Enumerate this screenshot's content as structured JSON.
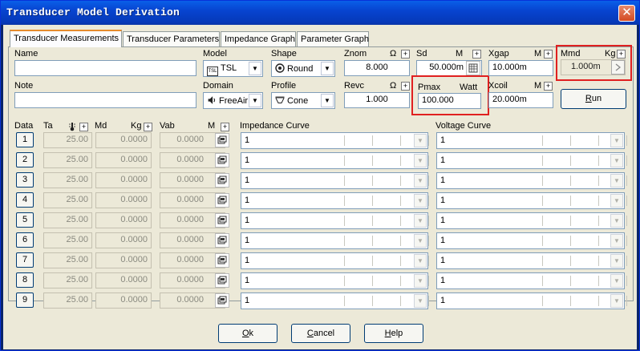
{
  "window": {
    "title": "Transducer Model Derivation",
    "close_glyph": "✕"
  },
  "tabs": [
    {
      "label": "Transducer Measurements",
      "active": true
    },
    {
      "label": "Transducer Parameters",
      "active": false
    },
    {
      "label": "Impedance Graph",
      "active": false
    },
    {
      "label": "Parameter Graph",
      "active": false
    }
  ],
  "form": {
    "name_label": "Name",
    "name_value": "",
    "note_label": "Note",
    "note_value": "",
    "model_label": "Model",
    "model_value": "TSL",
    "model_icon_text": "TSL",
    "domain_label": "Domain",
    "domain_value": "FreeAir",
    "shape_label": "Shape",
    "shape_value": "Round",
    "profile_label": "Profile",
    "profile_value": "Cone",
    "znom_label": "Znom",
    "znom_unit": "Ω",
    "znom_value": "8.000",
    "revc_label": "Revc",
    "revc_unit": "Ω",
    "revc_value": "1.000",
    "sd_label": "Sd",
    "sd_unit": "M",
    "sd_value": "50.000m",
    "pmax_label": "Pmax",
    "pmax_unit": "Watt",
    "pmax_value": "100.000",
    "xgap_label": "Xgap",
    "xgap_unit": "M",
    "xgap_value": "10.000m",
    "xcoil_label": "Xcoil",
    "xcoil_unit": "M",
    "xcoil_value": "20.000m",
    "mmd_label": "Mmd",
    "mmd_unit": "Kg",
    "mmd_value": "1.000m",
    "run_label_pre": "",
    "run_label_acc": "R",
    "run_label_post": "un"
  },
  "table": {
    "headers": {
      "data": "Data",
      "ta": "Ta",
      "md": "Md",
      "md_unit": "Kg",
      "vab": "Vab",
      "vab_unit": "M",
      "impedance": "Impedance Curve",
      "voltage": "Voltage Curve"
    },
    "rows": [
      {
        "num": "1",
        "ta": "25.00",
        "md": "0.0000",
        "vab": "0.0000",
        "imp": "1",
        "volt": "1"
      },
      {
        "num": "2",
        "ta": "25.00",
        "md": "0.0000",
        "vab": "0.0000",
        "imp": "1",
        "volt": "1"
      },
      {
        "num": "3",
        "ta": "25.00",
        "md": "0.0000",
        "vab": "0.0000",
        "imp": "1",
        "volt": "1"
      },
      {
        "num": "4",
        "ta": "25.00",
        "md": "0.0000",
        "vab": "0.0000",
        "imp": "1",
        "volt": "1"
      },
      {
        "num": "5",
        "ta": "25.00",
        "md": "0.0000",
        "vab": "0.0000",
        "imp": "1",
        "volt": "1"
      },
      {
        "num": "6",
        "ta": "25.00",
        "md": "0.0000",
        "vab": "0.0000",
        "imp": "1",
        "volt": "1"
      },
      {
        "num": "7",
        "ta": "25.00",
        "md": "0.0000",
        "vab": "0.0000",
        "imp": "1",
        "volt": "1"
      },
      {
        "num": "8",
        "ta": "25.00",
        "md": "0.0000",
        "vab": "0.0000",
        "imp": "1",
        "volt": "1"
      },
      {
        "num": "9",
        "ta": "25.00",
        "md": "0.0000",
        "vab": "0.0000",
        "imp": "1",
        "volt": "1"
      }
    ]
  },
  "footer": {
    "ok_acc": "O",
    "ok_rest": "k",
    "cancel_acc": "C",
    "cancel_rest": "ancel",
    "help_acc": "H",
    "help_rest": "elp"
  },
  "colors": {
    "title_bar": "#0744d0",
    "highlight": "#e02020",
    "face": "#ece9d8"
  },
  "icons": {
    "close": "close-icon",
    "model": "tsl-model-icon",
    "domain": "speaker-icon",
    "shape": "round-shape-icon",
    "profile": "cone-profile-icon",
    "sd": "calculator-icon",
    "mmd": "arrow-right-icon",
    "ta": "thermometer-icon",
    "vab": "vab-dialog-icon",
    "dropdown": "chevron-down-icon",
    "unit_toggle": "plus-icon"
  }
}
